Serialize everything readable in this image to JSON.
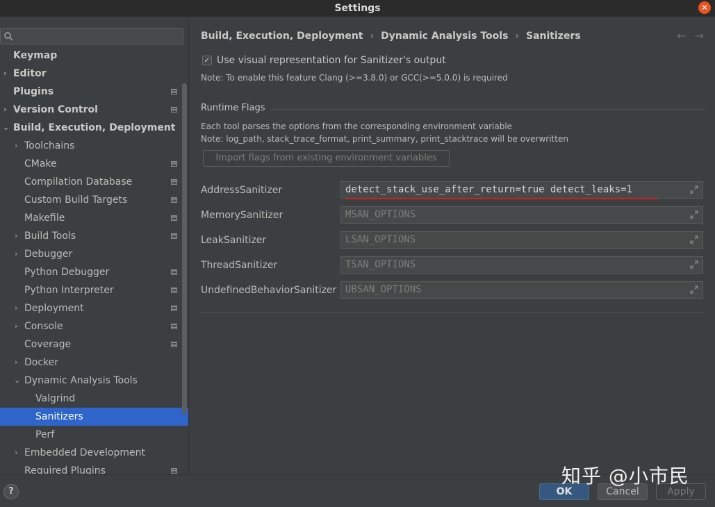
{
  "window": {
    "title": "Settings"
  },
  "search": {
    "placeholder": ""
  },
  "sidebar": {
    "items": [
      {
        "label": "Keymap"
      },
      {
        "label": "Editor"
      },
      {
        "label": "Plugins"
      },
      {
        "label": "Version Control"
      },
      {
        "label": "Build, Execution, Deployment"
      },
      {
        "label": "Toolchains"
      },
      {
        "label": "CMake"
      },
      {
        "label": "Compilation Database"
      },
      {
        "label": "Custom Build Targets"
      },
      {
        "label": "Makefile"
      },
      {
        "label": "Build Tools"
      },
      {
        "label": "Debugger"
      },
      {
        "label": "Python Debugger"
      },
      {
        "label": "Python Interpreter"
      },
      {
        "label": "Deployment"
      },
      {
        "label": "Console"
      },
      {
        "label": "Coverage"
      },
      {
        "label": "Docker"
      },
      {
        "label": "Dynamic Analysis Tools"
      },
      {
        "label": "Valgrind"
      },
      {
        "label": "Sanitizers"
      },
      {
        "label": "Perf"
      },
      {
        "label": "Embedded Development"
      },
      {
        "label": "Required Plugins"
      }
    ]
  },
  "breadcrumb": {
    "items": [
      "Build, Execution, Deployment",
      "Dynamic Analysis Tools",
      "Sanitizers"
    ],
    "separator": "›"
  },
  "main": {
    "visual_checkbox_label": "Use visual representation for Sanitizer's output",
    "visual_note": "Note: To enable this feature Clang (>=3.8.0) or GCC(>=5.0.0) is required",
    "runtime_flags_title": "Runtime Flags",
    "runtime_desc1": "Each tool parses the options from the corresponding environment variable",
    "runtime_desc2": "Note: log_path, stack_trace_format, print_summary, print_stacktrace will be overwritten",
    "import_button": "Import flags from existing environment variables",
    "sanitizers": [
      {
        "label": "AddressSanitizer",
        "value": "detect_stack_use_after_return=true detect_leaks=1"
      },
      {
        "label": "MemorySanitizer",
        "value": "MSAN_OPTIONS"
      },
      {
        "label": "LeakSanitizer",
        "value": "LSAN_OPTIONS"
      },
      {
        "label": "ThreadSanitizer",
        "value": "TSAN_OPTIONS"
      },
      {
        "label": "UndefinedBehaviorSanitizer",
        "value": "UBSAN_OPTIONS"
      }
    ]
  },
  "footer": {
    "help": "?",
    "ok": "OK",
    "cancel": "Cancel",
    "apply": "Apply",
    "watermark": "知乎 @小市民"
  },
  "colors": {
    "selected": "#2f65ca",
    "ok_button": "#365880",
    "highlight_underline": "#d02020",
    "close_button": "#e95420"
  }
}
